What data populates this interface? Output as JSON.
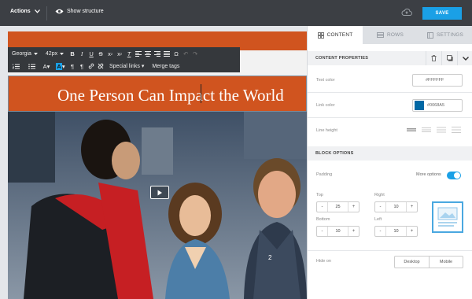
{
  "topbar": {
    "actions_label": "Actions",
    "show_structure_label": "Show structure",
    "save_label": "SAVE",
    "accent_color": "#1aa0e6"
  },
  "toolbar": {
    "font_family": "Georgia",
    "font_size": "42px",
    "special_links_label": "Special links",
    "merge_tags_label": "Merge tags"
  },
  "canvas": {
    "title": "One Person Can Impact the World",
    "title_bg_color": "#d0541f"
  },
  "panel": {
    "tabs": [
      {
        "label": "CONTENT",
        "active": true
      },
      {
        "label": "ROWS",
        "active": false
      },
      {
        "label": "SETTINGS",
        "active": false
      }
    ],
    "content_properties_label": "CONTENT PROPERTIES",
    "text_color_label": "Text color",
    "text_color_value": "#FFFFFF",
    "link_color_label": "Link color",
    "link_color_value": "#0068A5",
    "line_height_label": "Line height",
    "block_options_label": "BLOCK OPTIONS",
    "padding_label": "Padding",
    "more_options_label": "More options",
    "more_options_on": true,
    "padding": {
      "top_label": "Top",
      "top_value": "25",
      "right_label": "Right",
      "right_value": "10",
      "bottom_label": "Bottom",
      "bottom_value": "10",
      "left_label": "Left",
      "left_value": "10"
    },
    "hide_on_label": "Hide on",
    "hide_on_options": [
      "Desktop",
      "Mobile"
    ]
  }
}
